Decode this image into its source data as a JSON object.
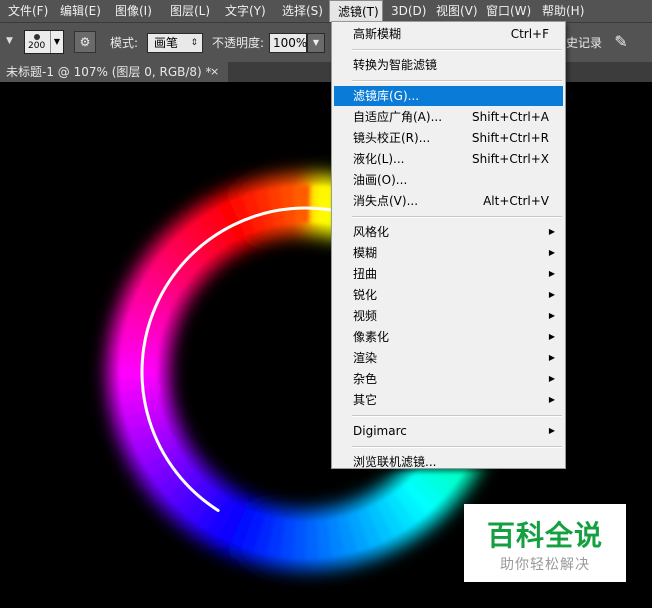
{
  "menubar": {
    "items": [
      {
        "label": "文件(F)"
      },
      {
        "label": "编辑(E)"
      },
      {
        "label": "图像(I)"
      },
      {
        "label": "图层(L)"
      },
      {
        "label": "文字(Y)"
      },
      {
        "label": "选择(S)"
      },
      {
        "label": "滤镜(T)",
        "active": true
      },
      {
        "label": "3D(D)"
      },
      {
        "label": "视图(V)"
      },
      {
        "label": "窗口(W)"
      },
      {
        "label": "帮助(H)"
      }
    ]
  },
  "options": {
    "brush_size": "200",
    "mode_label": "模式:",
    "mode_value": "画笔",
    "opacity_label": "不透明度:",
    "opacity_value": "100%",
    "history_label": "史记录",
    "icons": [
      "brush-preset-icon",
      "toggle-brush-panel-icon",
      "airbrush-icon"
    ]
  },
  "document": {
    "tab_title": "未标题-1 @ 107% (图层 0, RGB/8) *",
    "close_glyph": "×"
  },
  "filter_menu": {
    "items": [
      {
        "label": "高斯模糊",
        "shortcut": "Ctrl+F"
      },
      {
        "separator": true
      },
      {
        "label": "转换为智能滤镜"
      },
      {
        "separator": true
      },
      {
        "label": "滤镜库(G)...",
        "highlighted": true
      },
      {
        "label": "自适应广角(A)...",
        "shortcut": "Shift+Ctrl+A"
      },
      {
        "label": "镜头校正(R)...",
        "shortcut": "Shift+Ctrl+R"
      },
      {
        "label": "液化(L)...",
        "shortcut": "Shift+Ctrl+X"
      },
      {
        "label": "油画(O)..."
      },
      {
        "label": "消失点(V)...",
        "shortcut": "Alt+Ctrl+V"
      },
      {
        "separator": true
      },
      {
        "label": "风格化",
        "submenu": true
      },
      {
        "label": "模糊",
        "submenu": true
      },
      {
        "label": "扭曲",
        "submenu": true
      },
      {
        "label": "锐化",
        "submenu": true
      },
      {
        "label": "视频",
        "submenu": true
      },
      {
        "label": "像素化",
        "submenu": true
      },
      {
        "label": "渲染",
        "submenu": true
      },
      {
        "label": "杂色",
        "submenu": true
      },
      {
        "label": "其它",
        "submenu": true
      },
      {
        "separator": true
      },
      {
        "label": "Digimarc",
        "submenu": true
      },
      {
        "separator": true
      },
      {
        "label": "浏览联机滤镜..."
      }
    ],
    "highlight_color": "#0a7bd6"
  },
  "watermark": {
    "title": "百科全说",
    "subtitle": "助你轻松解决",
    "title_color": "#14a041"
  }
}
